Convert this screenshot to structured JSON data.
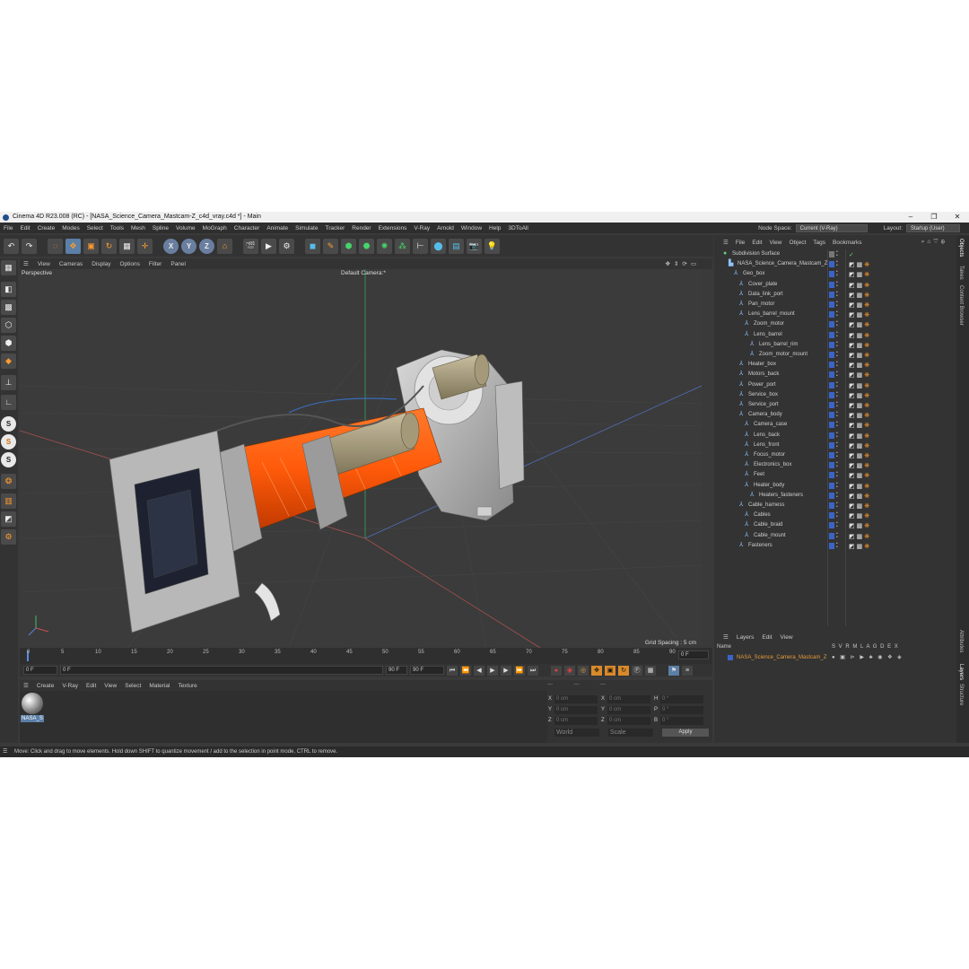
{
  "window": {
    "title": "Cinema 4D R23.008 (RC) - [NASA_Science_Camera_Mastcam-Z_c4d_vray.c4d *] - Main",
    "controls": [
      "–",
      "❐",
      "✕"
    ]
  },
  "menubar": {
    "items": [
      "File",
      "Edit",
      "Create",
      "Modes",
      "Select",
      "Tools",
      "Mesh",
      "Spline",
      "Volume",
      "MoGraph",
      "Character",
      "Animate",
      "Simulate",
      "Tracker",
      "Render",
      "Extensions",
      "V-Ray",
      "Arnold",
      "Window",
      "Help",
      "3DToAll"
    ],
    "node_space_label": "Node Space:",
    "node_space_value": "Current (V-Ray)",
    "layout_label": "Layout:",
    "layout_value": "Startup (User)"
  },
  "toolbar": {
    "axis_x": "X",
    "axis_y": "Y",
    "axis_z": "Z"
  },
  "viewport": {
    "menu": [
      "View",
      "Cameras",
      "Display",
      "Options",
      "Filter",
      "Panel"
    ],
    "projection": "Perspective",
    "camera": "Default Camera:*",
    "grid_spacing": "Grid Spacing : 5 cm"
  },
  "timeline": {
    "ticks": [
      "0",
      "5",
      "10",
      "15",
      "20",
      "25",
      "30",
      "35",
      "40",
      "45",
      "50",
      "55",
      "60",
      "65",
      "70",
      "75",
      "80",
      "85",
      "90"
    ],
    "current_frame": "0 F",
    "start_frame": "0 F",
    "range_start": "0 F",
    "range_end": "90 F",
    "end_frame": "90 F",
    "right_frame": "0 F"
  },
  "material_manager": {
    "menu": [
      "Create",
      "V-Ray",
      "Edit",
      "View",
      "Select",
      "Material",
      "Texture"
    ],
    "materials": [
      {
        "name": "NASA_S"
      }
    ]
  },
  "coordinates": {
    "rows": [
      {
        "a": "X",
        "av": "0 cm",
        "b": "X",
        "bv": "0 cm",
        "c": "H",
        "cv": "0 °"
      },
      {
        "a": "Y",
        "av": "0 cm",
        "b": "Y",
        "bv": "0 cm",
        "c": "P",
        "cv": "0 °"
      },
      {
        "a": "Z",
        "av": "0 cm",
        "b": "Z",
        "bv": "0 cm",
        "c": "B",
        "cv": "0 °"
      }
    ],
    "mode": "World",
    "scale_mode": "Scale",
    "apply": "Apply"
  },
  "object_manager": {
    "menu": [
      "File",
      "Edit",
      "View",
      "Object",
      "Tags",
      "Bookmarks"
    ],
    "objects": [
      {
        "name": "Subdivision Surface",
        "depth": 0
      },
      {
        "name": "NASA_Science_Camera_Mastcam_Z",
        "depth": 1
      },
      {
        "name": "Geo_box",
        "depth": 2
      },
      {
        "name": "Cover_plate",
        "depth": 3
      },
      {
        "name": "Data_link_port",
        "depth": 3
      },
      {
        "name": "Pan_motor",
        "depth": 3
      },
      {
        "name": "Lens_barrel_mount",
        "depth": 3
      },
      {
        "name": "Zoom_motor",
        "depth": 4
      },
      {
        "name": "Lens_barrel",
        "depth": 4
      },
      {
        "name": "Lens_barrel_rim",
        "depth": 5
      },
      {
        "name": "Zoom_motor_mount",
        "depth": 5
      },
      {
        "name": "Heater_box",
        "depth": 3
      },
      {
        "name": "Motors_back",
        "depth": 3
      },
      {
        "name": "Power_port",
        "depth": 3
      },
      {
        "name": "Service_box",
        "depth": 3
      },
      {
        "name": "Service_port",
        "depth": 3
      },
      {
        "name": "Camera_body",
        "depth": 3
      },
      {
        "name": "Camera_case",
        "depth": 4
      },
      {
        "name": "Lens_back",
        "depth": 4
      },
      {
        "name": "Lens_front",
        "depth": 4
      },
      {
        "name": "Focus_motor",
        "depth": 4
      },
      {
        "name": "Electronics_box",
        "depth": 4
      },
      {
        "name": "Feet",
        "depth": 4
      },
      {
        "name": "Heater_body",
        "depth": 4
      },
      {
        "name": "Heaters_fasteners",
        "depth": 5
      },
      {
        "name": "Cable_harness",
        "depth": 3
      },
      {
        "name": "Cables",
        "depth": 4
      },
      {
        "name": "Cable_braid",
        "depth": 4
      },
      {
        "name": "Cable_mount",
        "depth": 4
      },
      {
        "name": "Fasteners",
        "depth": 3
      }
    ]
  },
  "layers": {
    "menu": [
      "Layers",
      "Edit",
      "View"
    ],
    "header_name": "Name",
    "header_flags": "S V R M L A G D E X",
    "rows": [
      {
        "name": "NASA_Science_Camera_Mastcam_Z"
      }
    ],
    "layer_color": "#3b64c9"
  },
  "side_tabs": [
    "Objects",
    "Takes",
    "Content Browser",
    "Attributes",
    "Layers",
    "Structure"
  ],
  "status": "Move: Click and drag to move elements. Hold down SHIFT to quantize movement / add to the selection in point mode, CTRL to remove."
}
